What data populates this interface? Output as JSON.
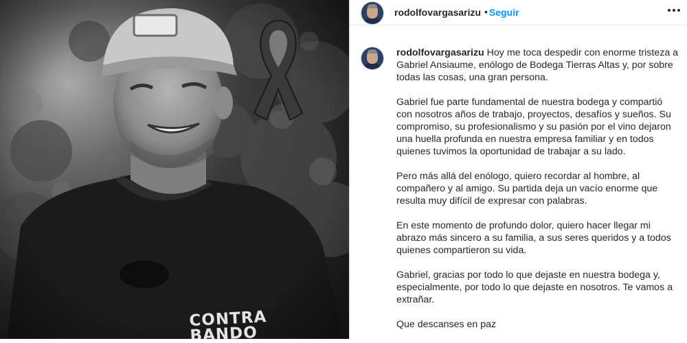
{
  "post": {
    "username": "rodolfovargasarizu",
    "separator": "•",
    "follow_label": "Seguir",
    "more_icon": "more-horizontal-icon"
  },
  "photo": {
    "shirt_text_line1": "CONTRA",
    "shirt_text_line2": "BANDO",
    "ribbon_icon": "mourning-ribbon-icon"
  },
  "caption": {
    "username": "rodolfovargasarizu",
    "paragraph1": "Hoy me toca despedir con enorme tristeza a Gabriel Ansiaume, enólogo de Bodega Tierras Altas y, por sobre todas las cosas, una gran persona.",
    "paragraph2": "Gabriel fue parte fundamental de nuestra bodega y compartió con nosotros años de trabajo, proyectos, desafíos y sueños. Su compromiso, su profesionalismo y su pasión por el vino dejaron una huella profunda en nuestra empresa familiar y en todos quienes tuvimos la oportunidad de trabajar a su lado.",
    "paragraph3": "Pero más allá del enólogo, quiero recordar al hombre, al compañero y al amigo. Su partida deja un vacío enorme que resulta muy difícil de expresar con palabras.",
    "paragraph4": "En este momento de profundo dolor, quiero hacer llegar mi abrazo más sincero a su familia, a sus seres queridos y a todos quienes compartieron su vida.",
    "paragraph5": "Gabriel, gracias por todo lo que dejaste en nuestra bodega y, especialmente, por todo lo que dejaste en nosotros. Te vamos a extrañar.",
    "paragraph6": "Que descanses en paz"
  }
}
